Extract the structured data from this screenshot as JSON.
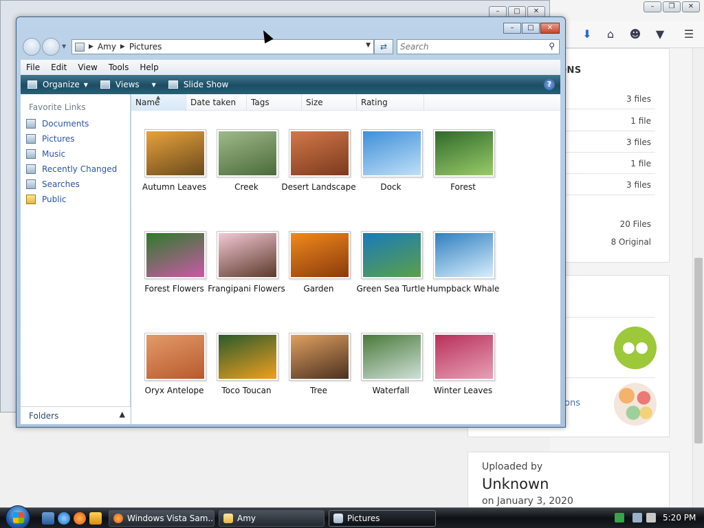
{
  "browser_panel": {
    "title": "ONS",
    "rows": [
      "3 files",
      "1 file",
      "3 files",
      "1 file",
      "3 files"
    ],
    "total_files": "20 Files",
    "original_count": "8 Original",
    "link_tail": "ons"
  },
  "upload_panel": {
    "label": "Uploaded by",
    "name": "Unknown",
    "date": "on January 3, 2020"
  },
  "explorer": {
    "breadcrumb": [
      "Amy",
      "Pictures"
    ],
    "search_placeholder": "Search",
    "menus": [
      "File",
      "Edit",
      "View",
      "Tools",
      "Help"
    ],
    "commands": {
      "organize": "Organize",
      "views": "Views",
      "slideshow": "Slide Show"
    },
    "favorite_links_title": "Favorite Links",
    "favorite_links": [
      {
        "label": "Documents",
        "icon": "documents-icon"
      },
      {
        "label": "Pictures",
        "icon": "pictures-icon"
      },
      {
        "label": "Music",
        "icon": "music-icon"
      },
      {
        "label": "Recently Changed",
        "icon": "recently-changed-icon"
      },
      {
        "label": "Searches",
        "icon": "searches-icon"
      },
      {
        "label": "Public",
        "icon": "public-folder-icon"
      }
    ],
    "folders_label": "Folders",
    "columns": [
      "Name",
      "Date taken",
      "Tags",
      "Size",
      "Rating"
    ],
    "pictures": [
      {
        "name": "Autumn Leaves",
        "colors": [
          "#e8a23c",
          "#6a4a1c"
        ]
      },
      {
        "name": "Creek",
        "colors": [
          "#9fb98a",
          "#4b6a3a"
        ]
      },
      {
        "name": "Desert Landscape",
        "colors": [
          "#d2784a",
          "#7b3a1c"
        ]
      },
      {
        "name": "Dock",
        "colors": [
          "#3f8fd8",
          "#bfe0f8"
        ]
      },
      {
        "name": "Forest",
        "colors": [
          "#2f6a2a",
          "#9acb6a"
        ]
      },
      {
        "name": "Forest Flowers",
        "colors": [
          "#2f7a2c",
          "#c95aa6"
        ]
      },
      {
        "name": "Frangipani Flowers",
        "colors": [
          "#f3c8d5",
          "#5b3a2a"
        ]
      },
      {
        "name": "Garden",
        "colors": [
          "#f08a1c",
          "#8a3a0c"
        ]
      },
      {
        "name": "Green Sea Turtle",
        "colors": [
          "#1a7ab8",
          "#5ba04a"
        ]
      },
      {
        "name": "Humpback Whale",
        "colors": [
          "#2f7fc0",
          "#d8eefc"
        ]
      },
      {
        "name": "Oryx Antelope",
        "colors": [
          "#e39a6a",
          "#b85a2c"
        ]
      },
      {
        "name": "Toco Toucan",
        "colors": [
          "#2a5a2c",
          "#f0a020"
        ]
      },
      {
        "name": "Tree",
        "colors": [
          "#e0a060",
          "#4a3020"
        ]
      },
      {
        "name": "Waterfall",
        "colors": [
          "#4a7a3a",
          "#cfe0d8"
        ]
      },
      {
        "name": "Winter Leaves",
        "colors": [
          "#b8305a",
          "#e8a0b8"
        ]
      }
    ]
  },
  "taskbar": {
    "buttons": [
      "Windows Vista Sam...",
      "Amy",
      "Pictures"
    ],
    "clock": "5:20 PM"
  }
}
